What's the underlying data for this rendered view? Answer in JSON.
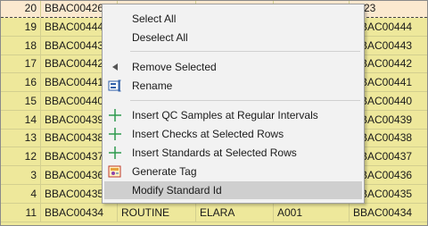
{
  "grid": {
    "rows": [
      [
        "20",
        "BBAC00426",
        "",
        "",
        "",
        "S-23"
      ],
      [
        "19",
        "BBAC00444",
        "",
        "",
        "",
        "BBAC00444"
      ],
      [
        "18",
        "BBAC00443",
        "",
        "",
        "",
        "BBAC00443"
      ],
      [
        "17",
        "BBAC00442",
        "",
        "",
        "",
        "BBAC00442"
      ],
      [
        "16",
        "BBAC00441",
        "",
        "",
        "",
        "BBAC00441"
      ],
      [
        "15",
        "BBAC00440",
        "",
        "",
        "",
        "BBAC00440"
      ],
      [
        "14",
        "BBAC00439",
        "",
        "",
        "",
        "BBAC00439"
      ],
      [
        "13",
        "BBAC00438",
        "",
        "",
        "",
        "BBAC00438"
      ],
      [
        "12",
        "BBAC00437",
        "",
        "",
        "",
        "BBAC00437"
      ],
      [
        "3",
        "BBAC00436",
        "",
        "",
        "",
        "BBAC00436"
      ],
      [
        "4",
        "BBAC00435",
        "ROUTINE",
        "ELARA",
        "A001",
        "BBAC00435"
      ],
      [
        "11",
        "BBAC00434",
        "ROUTINE",
        "ELARA",
        "A001",
        "BBAC00434"
      ]
    ]
  },
  "context_menu": {
    "select_all": "Select All",
    "deselect_all": "Deselect All",
    "remove_selected": "Remove Selected",
    "rename": "Rename",
    "insert_qc": "Insert QC Samples at Regular Intervals",
    "insert_checks": "Insert Checks at Selected Rows",
    "insert_standards": "Insert Standards at Selected Rows",
    "generate_tag": "Generate Tag",
    "modify_standard_id": "Modify Standard Id"
  },
  "colors": {
    "row_background": "#eee89b",
    "first_row_background": "#fbe9cf",
    "menu_background": "#f2f2f2",
    "menu_highlight": "#cfcfcf",
    "insert_icon": "#2e9b4e"
  }
}
